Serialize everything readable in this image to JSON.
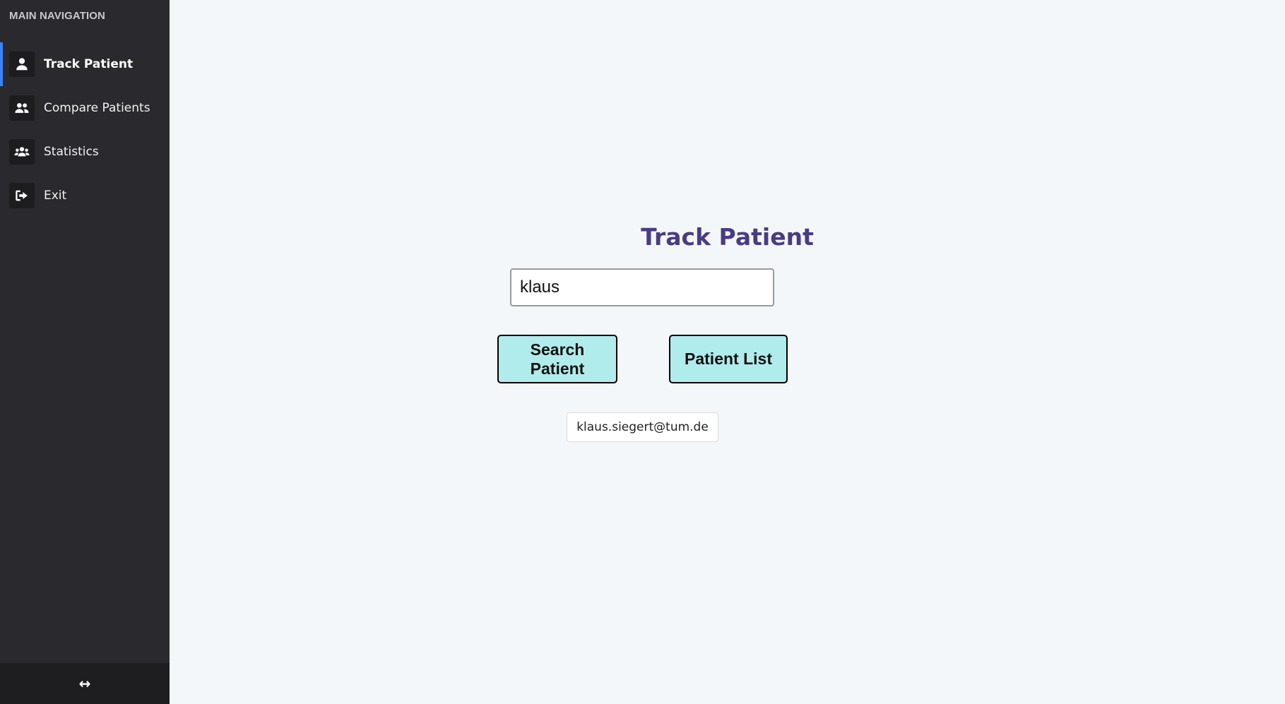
{
  "sidebar": {
    "header": "MAIN NAVIGATION",
    "items": [
      {
        "label": "Track Patient",
        "icon": "user-icon",
        "active": true
      },
      {
        "label": "Compare Patients",
        "icon": "user-pair-icon",
        "active": false
      },
      {
        "label": "Statistics",
        "icon": "users-group-icon",
        "active": false
      },
      {
        "label": "Exit",
        "icon": "sign-out-icon",
        "active": false
      }
    ],
    "footer_icon": "↔",
    "accent_color": "#3b82f6"
  },
  "main": {
    "title": "Track Patient",
    "search": {
      "value": "klaus",
      "placeholder": ""
    },
    "buttons": {
      "search": "Search Patient",
      "list": "Patient List"
    },
    "user_email": "klaus.siegert@tum.de"
  },
  "colors": {
    "title": "#4a3b85",
    "button_bg": "#b1ecec",
    "sidebar_bg": "#2a2a2e",
    "main_bg": "#f3f7fa"
  }
}
